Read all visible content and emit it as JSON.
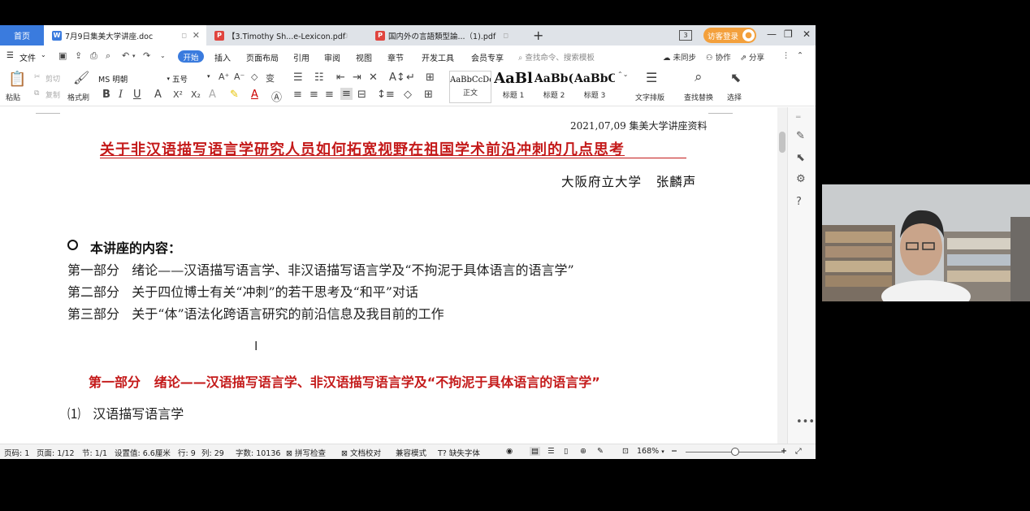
{
  "tabbar": {
    "home_label": "首页",
    "tabs": [
      {
        "label": "7月9日集美大学讲座.doc",
        "type": "W"
      },
      {
        "label": "【3.Timothy Sh...e-Lexicon.pdf",
        "type": "P"
      },
      {
        "label": "国内外の言語類型論...（1).pdf",
        "type": "P"
      }
    ],
    "window_count": "3",
    "visitor_login": "访客登录"
  },
  "menubar": {
    "file": "文件",
    "items": [
      "开始",
      "插入",
      "页面布局",
      "引用",
      "审阅",
      "视图",
      "章节",
      "开发工具",
      "会员专享"
    ],
    "search_placeholder": "查找命令、搜索模板",
    "unsynced": "未同步",
    "collab": "协作",
    "share": "分享"
  },
  "ribbon": {
    "paste": "粘贴",
    "cut": "剪切",
    "copy": "复制",
    "format_painter": "格式刷",
    "font_name": "MS 明朝",
    "font_size": "五号",
    "styles": [
      {
        "sample": "AaBbCcDd",
        "name": "正文"
      },
      {
        "sample": "AaBl",
        "name": "标题 1"
      },
      {
        "sample": "AaBb(",
        "name": "标题 2"
      },
      {
        "sample": "AaBbC",
        "name": "标题 3"
      }
    ],
    "text_layout": "文字排版",
    "find_replace": "查找替换",
    "select": "选择"
  },
  "document": {
    "date_line": "2021,07,09  集美大学讲座资料",
    "title": "关于非汉语描写语言学研究人员如何拓宽视野在祖国学术前沿冲刺的几点思考",
    "author": "大阪府立大学   张麟声",
    "contents_heading": "本讲座的内容：",
    "contents": [
      "第一部分   绪论——汉语描写语言学、非汉语描写语言学及“不拘泥于具体语言的语言学”",
      "第二部分   关于四位博士有关“冲刺”的若干思考及“和平”对话",
      "第三部分   关于“体”语法化跨语言研究的前沿信息及我目前的工作"
    ],
    "part1_heading": "第一部分   绪论——汉语描写语言学、非汉语描写语言学及“不拘泥于具体语言的语言学”",
    "sub_heading": "⑴   汉语描写语言学"
  },
  "statusbar": {
    "page_code": "页码: 1",
    "page": "页面: 1/12",
    "section": "节: 1/1",
    "setting": "设置值: 6.6厘米",
    "row": "行: 9",
    "col": "列: 29",
    "words": "字数: 10136",
    "spell": "拼写检查",
    "proof": "文档校对",
    "compat": "兼容模式",
    "missing_font": "缺失字体",
    "zoom": "168%"
  }
}
